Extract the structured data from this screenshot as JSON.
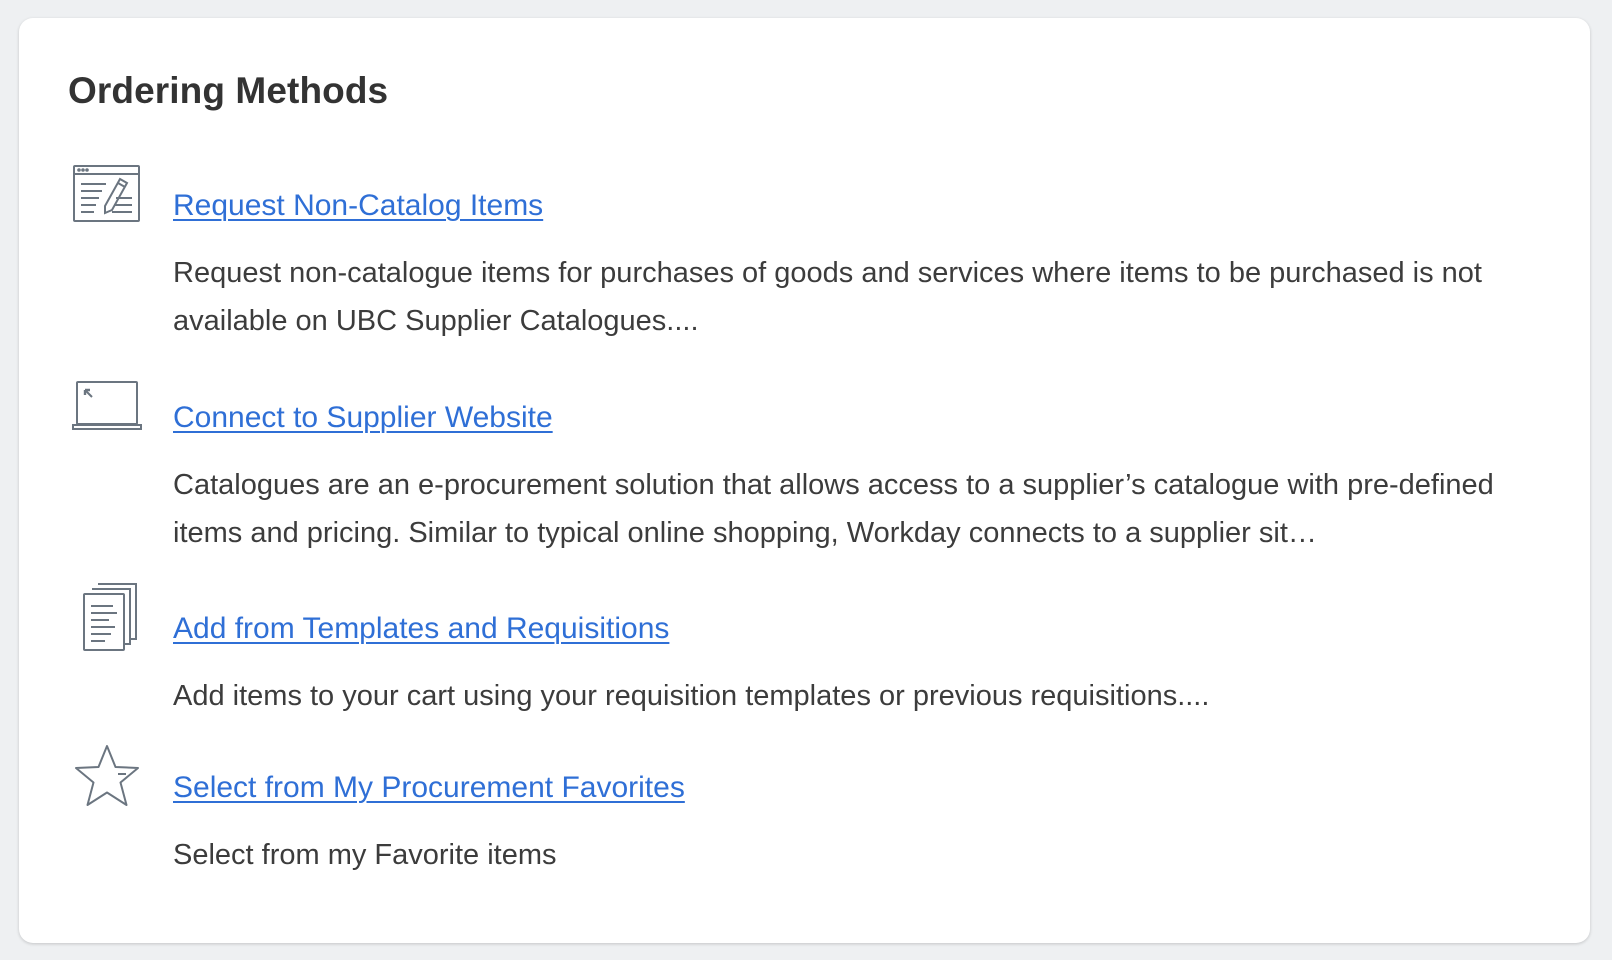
{
  "card": {
    "title": "Ordering Methods"
  },
  "methods": [
    {
      "icon": "form-edit-icon",
      "link": "Request Non-Catalog Items",
      "description": "Request non-catalogue items for purchases of goods and services where items to be purchased is not available on UBC Supplier Catalogues...."
    },
    {
      "icon": "laptop-cursor-icon",
      "link": "Connect to Supplier Website",
      "description": "Catalogues are an e-procurement solution that allows access to a supplier’s catalogue with pre-defined items and pricing. Similar to typical online shopping, Workday connects to a supplier sit…"
    },
    {
      "icon": "documents-stack-icon",
      "link": "Add from Templates and Requisitions",
      "description": "Add items to your cart using your requisition templates or previous requisitions...."
    },
    {
      "icon": "star-icon",
      "link": "Select from My Procurement Favorites",
      "description": "Select from my Favorite items"
    }
  ],
  "colors": {
    "link": "#2f6fd6",
    "text": "#3c3c3c",
    "icon": "#6b7580",
    "background": "#eef0f2"
  }
}
